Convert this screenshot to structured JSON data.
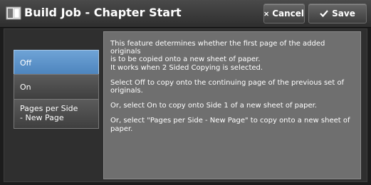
{
  "header": {
    "title": "Build Job - Chapter Start",
    "icon": "document-icon",
    "cancel_label": "Cancel",
    "save_label": "Save"
  },
  "options": [
    {
      "label": "Off",
      "selected": true
    },
    {
      "label": "On",
      "selected": false
    },
    {
      "label_line1": "Pages per Side",
      "label_line2": "- New Page",
      "selected": false
    }
  ],
  "description": {
    "p1_line1": "This feature determines whether the first page of the added originals",
    "p1_line2": "is to be copied onto a new sheet of paper.",
    "p1_line3": " It works when 2 Sided Copying is selected.",
    "p2_line1": "Select Off to copy onto the continuing page of the previous set of",
    "p2_line2": "originals.",
    "p3": "Or, select On to copy onto Side 1 of a new sheet of paper.",
    "p4_line1": "Or, select \"Pages per Side - New Page\" to copy onto a new sheet of",
    "p4_line2": "paper."
  },
  "colors": {
    "selected": "#5f96cc",
    "background": "#1c1c1c",
    "description_bg": "#6f6f6f"
  }
}
